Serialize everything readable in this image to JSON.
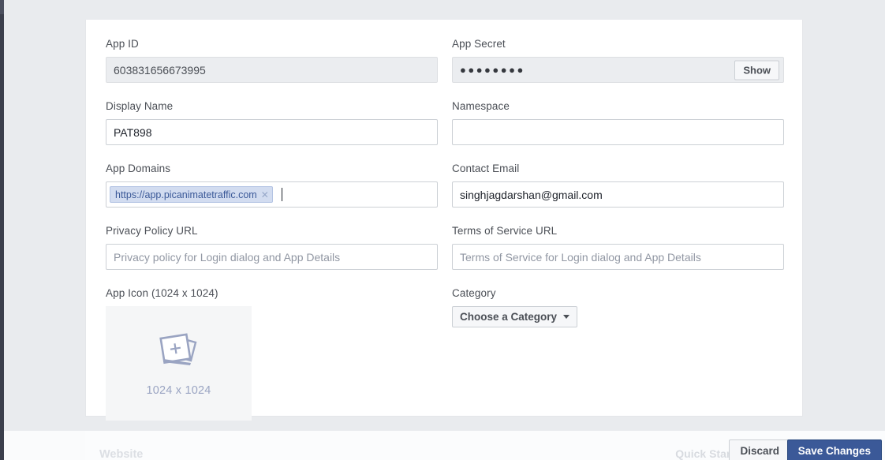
{
  "form": {
    "left_column": [
      {
        "label": "App ID",
        "type": "readonly-text",
        "value": "603831656673995",
        "placeholder": "",
        "name": "app-id"
      },
      {
        "label": "Display Name",
        "type": "text",
        "value": "PAT898",
        "placeholder": "",
        "name": "display-name"
      },
      {
        "label": "App Domains",
        "type": "token",
        "value": "",
        "placeholder": "",
        "name": "app-domains",
        "tokens": [
          {
            "text": "https://app.picanimatetraffic.com",
            "remove_icon": "close-icon"
          }
        ]
      },
      {
        "label": "Privacy Policy URL",
        "type": "text",
        "value": "",
        "placeholder": "Privacy policy for Login dialog and App Details",
        "name": "privacy-policy-url"
      }
    ],
    "right_column": [
      {
        "label": "App Secret",
        "type": "readonly-secret",
        "value": "●●●●●●●●",
        "placeholder": "",
        "name": "app-secret",
        "action_label": "Show"
      },
      {
        "label": "Namespace",
        "type": "text",
        "value": "",
        "placeholder": "",
        "name": "namespace"
      },
      {
        "label": "Contact Email",
        "type": "text",
        "value": "singhjagdarshan@gmail.com",
        "placeholder": "",
        "name": "contact-email"
      },
      {
        "label": "Terms of Service URL",
        "type": "text",
        "value": "",
        "placeholder": "Terms of Service for Login dialog and App Details",
        "name": "terms-of-service-url"
      }
    ],
    "app_icon": {
      "label": "App Icon (1024 x 1024)",
      "placeholder_caption": "1024 x 1024",
      "icon": "add-photos-icon"
    },
    "category": {
      "label": "Category",
      "selected": "Choose a Category",
      "caret_icon": "chevron-down-icon"
    }
  },
  "bottom_bar": {
    "website_label": "Website",
    "quick_start_label": "Quick Start",
    "discard_label": "Discard",
    "save_label": "Save Changes"
  },
  "colors": {
    "brand_blue": "#3b5998",
    "page_bg": "#e9ebee",
    "card_bg": "#ffffff",
    "field_disabled_bg": "#ebedf0",
    "token_bg": "#d2dcf0",
    "token_text": "#3b5998",
    "icon_placeholder": "#9aa4c2"
  }
}
